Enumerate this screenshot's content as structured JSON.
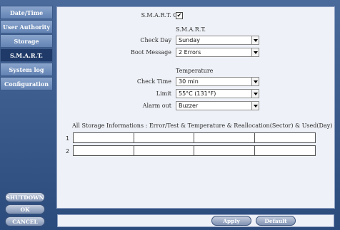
{
  "sidebar": {
    "items": [
      {
        "label": "Date/Time"
      },
      {
        "label": "User Authority"
      },
      {
        "label": "Storage"
      },
      {
        "label": "S.M.A.R.T."
      },
      {
        "label": "System log"
      },
      {
        "label": "Configuration"
      }
    ],
    "buttons": {
      "shutdown": "SHUTDOWN",
      "ok": "OK",
      "cancel": "CANCEL"
    }
  },
  "smart": {
    "on_label": "S.M.A.R.T. On",
    "on_checked": "✔",
    "section_label": "S.M.A.R.T.",
    "check_day_label": "Check Day",
    "check_day_value": "Sunday",
    "boot_message_label": "Boot Message",
    "boot_message_value": "2 Errors"
  },
  "temperature": {
    "section_label": "Temperature",
    "check_time_label": "Check Time",
    "check_time_value": "30 min",
    "limit_label": "Limit",
    "limit_value": "55°C (131°F)",
    "alarm_out_label": "Alarm out",
    "alarm_out_value": "Buzzer"
  },
  "storage_info": {
    "title": "All Storage Informations  :  Error/Test & Temperature & Reallocation(Sector) & Used(Day)",
    "rows": [
      {
        "num": "1"
      },
      {
        "num": "2"
      }
    ]
  },
  "footer": {
    "apply": "Apply",
    "default": "Default"
  }
}
